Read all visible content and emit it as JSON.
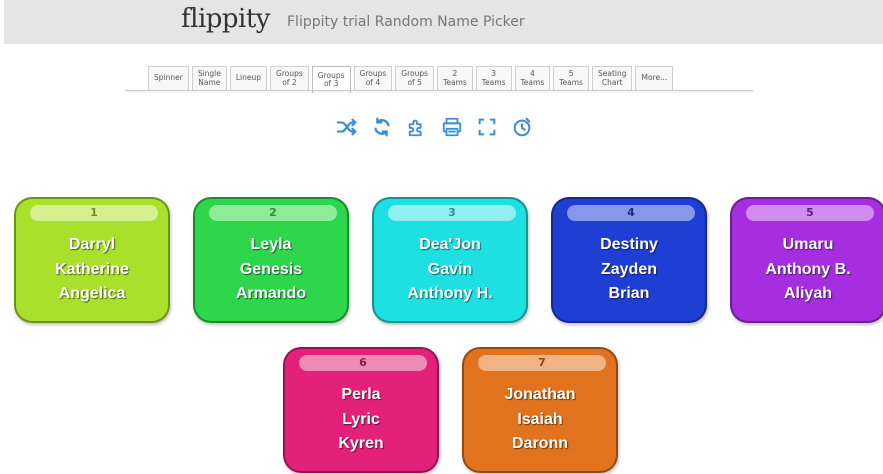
{
  "header": {
    "logo": "flippity",
    "title": "Flippity trial Random Name Picker"
  },
  "tabs": [
    {
      "label": "Spinner"
    },
    {
      "label": "Single\nName"
    },
    {
      "label": "Lineup"
    },
    {
      "label": "Groups\nof 2"
    },
    {
      "label": "Groups\nof 3",
      "active": true
    },
    {
      "label": "Groups\nof 4"
    },
    {
      "label": "Groups\nof 5"
    },
    {
      "label": "2\nTeams"
    },
    {
      "label": "3\nTeams"
    },
    {
      "label": "4\nTeams"
    },
    {
      "label": "5\nTeams"
    },
    {
      "label": "Seating\nChart"
    },
    {
      "label": "More..."
    }
  ],
  "toolbar": {
    "icon_color": "#3b8fd6",
    "icons": [
      "shuffle-icon",
      "refresh-icon",
      "puzzle-icon",
      "print-icon",
      "fullscreen-icon",
      "timer-icon"
    ]
  },
  "groups": [
    {
      "number": "1",
      "names": [
        "Darryl",
        "Katherine",
        "Angelica"
      ],
      "color": "#a8e02b",
      "label_color": "#d6f08f",
      "number_color": "#6f8f2a"
    },
    {
      "number": "2",
      "names": [
        "Leyla",
        "Genesis",
        "Armando"
      ],
      "color": "#2ed64c",
      "label_color": "#8eeb9a",
      "number_color": "#2f8a3d"
    },
    {
      "number": "3",
      "names": [
        "Dea'Jon",
        "Gavin",
        "Anthony H."
      ],
      "color": "#1ee0e3",
      "label_color": "#90f0f1",
      "number_color": "#2a8f92"
    },
    {
      "number": "4",
      "names": [
        "Destiny",
        "Zayden",
        "Brian"
      ],
      "color": "#1f3fd4",
      "label_color": "#8598ea",
      "number_color": "#1c2b7a"
    },
    {
      "number": "5",
      "names": [
        "Umaru",
        "Anthony B.",
        "Aliyah"
      ],
      "color": "#a52ee0",
      "label_color": "#d28cee",
      "number_color": "#5e1f80"
    },
    {
      "number": "6",
      "names": [
        "Perla",
        "Lyric",
        "Kyren"
      ],
      "color": "#e3217a",
      "label_color": "#ef8ab6",
      "number_color": "#8a1b4b"
    },
    {
      "number": "7",
      "names": [
        "Jonathan",
        "Isaiah",
        "Daronn"
      ],
      "color": "#e2731e",
      "label_color": "#efb385",
      "number_color": "#8a4a16"
    }
  ]
}
